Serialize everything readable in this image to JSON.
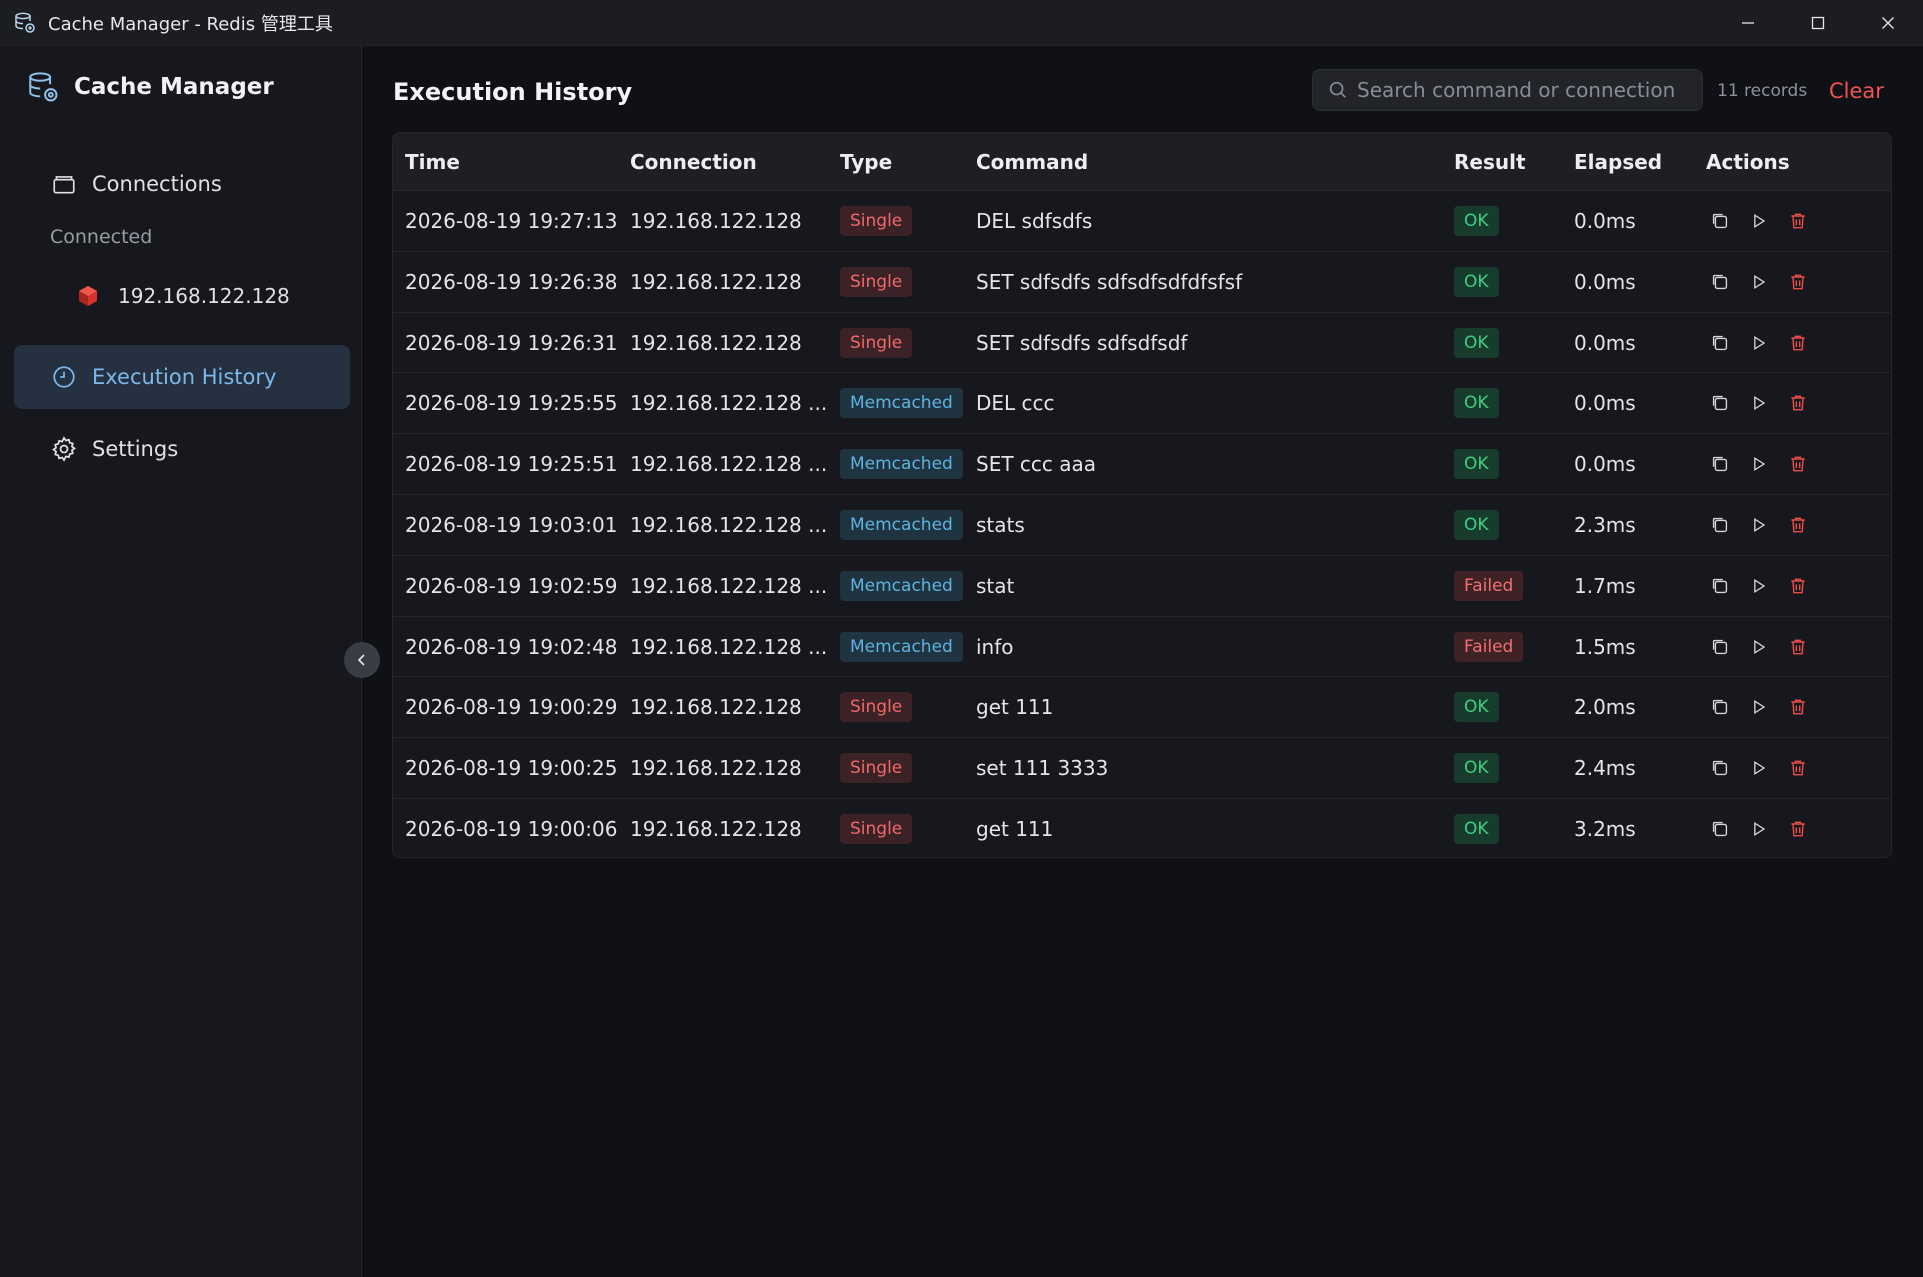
{
  "window": {
    "title": "Cache Manager - Redis 管理工具",
    "controls": [
      "minimize",
      "maximize",
      "close"
    ]
  },
  "colors": {
    "accent": "#7cb8ea",
    "danger": "#ef5350",
    "ok": "#3fcf83",
    "memcached": "#5fb3df"
  },
  "sidebar": {
    "brand": "Cache Manager",
    "items": [
      {
        "label": "Connections",
        "icon": "connections-icon"
      },
      {
        "label": "Execution History",
        "icon": "clock-icon",
        "active": true
      },
      {
        "label": "Settings",
        "icon": "gear-icon"
      }
    ],
    "section_label": "Connected",
    "connections": [
      {
        "label": "192.168.122.128",
        "icon": "redis-cube-icon"
      }
    ]
  },
  "main": {
    "title": "Execution History",
    "search_placeholder": "Search command or connection",
    "records": "11 records",
    "clear_label": "Clear",
    "columns": [
      "Time",
      "Connection",
      "Type",
      "Command",
      "Result",
      "Elapsed",
      "Actions"
    ],
    "rows": [
      {
        "time": "2026-08-19 19:27:13",
        "connection": "192.168.122.128",
        "type": "Single",
        "command": "DEL sdfsdfs",
        "result": "OK",
        "elapsed": "0.0ms"
      },
      {
        "time": "2026-08-19 19:26:38",
        "connection": "192.168.122.128",
        "type": "Single",
        "command": "SET sdfsdfs sdfsdfsdfdfsfsf",
        "result": "OK",
        "elapsed": "0.0ms"
      },
      {
        "time": "2026-08-19 19:26:31",
        "connection": "192.168.122.128",
        "type": "Single",
        "command": "SET sdfsdfs sdfsdfsdf",
        "result": "OK",
        "elapsed": "0.0ms"
      },
      {
        "time": "2026-08-19 19:25:55",
        "connection": "192.168.122.128 ...",
        "type": "Memcached",
        "command": "DEL ccc",
        "result": "OK",
        "elapsed": "0.0ms"
      },
      {
        "time": "2026-08-19 19:25:51",
        "connection": "192.168.122.128 ...",
        "type": "Memcached",
        "command": "SET ccc aaa",
        "result": "OK",
        "elapsed": "0.0ms"
      },
      {
        "time": "2026-08-19 19:03:01",
        "connection": "192.168.122.128 ...",
        "type": "Memcached",
        "command": "stats",
        "result": "OK",
        "elapsed": "2.3ms"
      },
      {
        "time": "2026-08-19 19:02:59",
        "connection": "192.168.122.128 ...",
        "type": "Memcached",
        "command": "stat",
        "result": "Failed",
        "elapsed": "1.7ms"
      },
      {
        "time": "2026-08-19 19:02:48",
        "connection": "192.168.122.128 ...",
        "type": "Memcached",
        "command": "info",
        "result": "Failed",
        "elapsed": "1.5ms"
      },
      {
        "time": "2026-08-19 19:00:29",
        "connection": "192.168.122.128",
        "type": "Single",
        "command": "get 111",
        "result": "OK",
        "elapsed": "2.0ms"
      },
      {
        "time": "2026-08-19 19:00:25",
        "connection": "192.168.122.128",
        "type": "Single",
        "command": "set 111 3333",
        "result": "OK",
        "elapsed": "2.4ms"
      },
      {
        "time": "2026-08-19 19:00:06",
        "connection": "192.168.122.128",
        "type": "Single",
        "command": "get 111",
        "result": "OK",
        "elapsed": "3.2ms"
      }
    ],
    "row_actions": [
      "copy-icon",
      "play-icon",
      "trash-icon"
    ]
  }
}
